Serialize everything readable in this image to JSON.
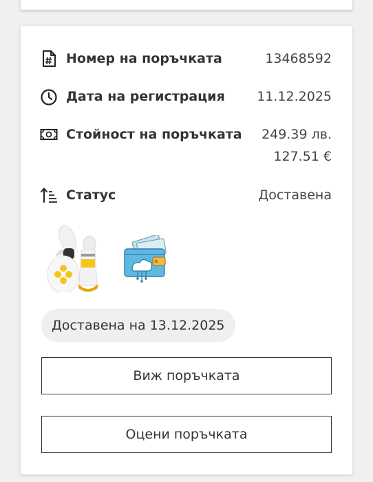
{
  "order": {
    "number_label": "Номер на поръчката",
    "number_value": "13468592",
    "date_label": "Дата на регистрация",
    "date_value": "11.12.2025",
    "price_label": "Стойност на поръчката",
    "price_bgn": "249.39 лв.",
    "price_eur": "127.51 €",
    "status_label": "Статус",
    "status_value": "Доставена"
  },
  "products": [
    {
      "icon": "breast-pump-product-image"
    },
    {
      "icon": "cloud-wallet-product-image"
    }
  ],
  "delivery": {
    "badge": "Доставена на 13.12.2025"
  },
  "actions": {
    "view_order": "Виж поръчката",
    "rate_order": "Оцени поръчката"
  },
  "colors": {
    "text": "#333333",
    "pill_bg": "#efefef",
    "accent_yellow": "#f5c518",
    "accent_blue": "#4aa8d8"
  }
}
